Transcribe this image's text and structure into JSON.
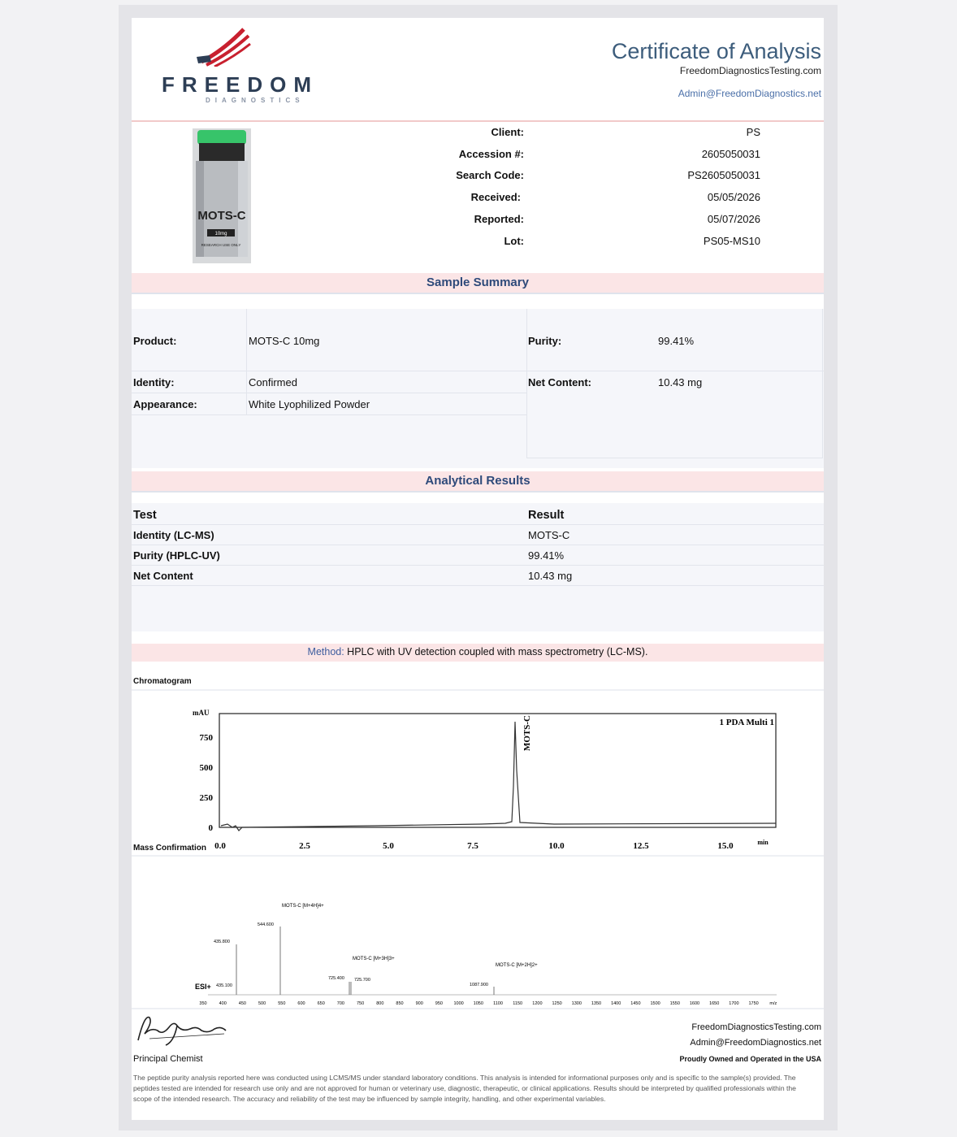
{
  "header": {
    "logo_word": "FREEDOM",
    "logo_sub": "DIAGNOSTICS",
    "title": "Certificate of Analysis",
    "website": "FreedomDiagnosticsTesting.com",
    "email": "Admin@FreedomDiagnostics.net"
  },
  "vial": {
    "label": "MOTS-C",
    "dose": "10mg",
    "note": "RESEARCH USE ONLY"
  },
  "info": [
    {
      "label": "Client:",
      "value": "PS"
    },
    {
      "label": "Accession #:",
      "value": "2605050031"
    },
    {
      "label": "Search Code:",
      "value": "PS2605050031"
    },
    {
      "label": "Received:",
      "value": "05/05/2026"
    },
    {
      "label": "Reported:",
      "value": "05/07/2026"
    },
    {
      "label": "Lot:",
      "value": "PS05-MS10"
    }
  ],
  "sample_summary": {
    "title": "Sample Summary",
    "product_label": "Product:",
    "product": "MOTS-C 10mg",
    "identity_label": "Identity:",
    "identity": "Confirmed",
    "appearance_label": "Appearance:",
    "appearance": "White Lyophilized Powder",
    "purity_label": "Purity:",
    "purity": "99.41%",
    "net_label": "Net Content:",
    "net": "10.43 mg"
  },
  "analytical": {
    "title": "Analytical Results",
    "col_test": "Test",
    "col_result": "Result",
    "rows": [
      {
        "test": "Identity (LC-MS)",
        "result": "MOTS-C"
      },
      {
        "test": "Purity (HPLC-UV)",
        "result": "99.41%"
      },
      {
        "test": "Net Content",
        "result": "10.43 mg"
      }
    ]
  },
  "method": {
    "label": "Method:",
    "text": " HPLC with UV detection coupled with mass spectrometry (LC-MS)."
  },
  "chromatogram": {
    "section": "Chromatogram",
    "y_unit": "mAU",
    "x_unit": "min",
    "legend": "1 PDA Multi 1",
    "peak_label": "MOTS-C",
    "y_ticks": [
      "750",
      "500",
      "250",
      "0"
    ],
    "x_ticks": [
      "0.0",
      "2.5",
      "5.0",
      "7.5",
      "10.0",
      "12.5",
      "15.0"
    ]
  },
  "mass": {
    "section": "Mass Confirmation",
    "mode": "ESI+",
    "x_unit": "m/z",
    "peaks": [
      {
        "mz_label": "435.100"
      },
      {
        "mz_label": "435.800"
      },
      {
        "mz_label": "544.600",
        "name": "MOTS-C [M+4H]4+"
      },
      {
        "mz_label": "725.400"
      },
      {
        "mz_label": "725.700",
        "name": "MOTS-C [M+3H]3+"
      },
      {
        "mz_label": "1087.900",
        "name": "MOTS-C [M+2H]2+"
      }
    ],
    "x_ticks": [
      "350",
      "400",
      "450",
      "500",
      "550",
      "600",
      "650",
      "700",
      "750",
      "800",
      "850",
      "900",
      "950",
      "1000",
      "1050",
      "1100",
      "1150",
      "1200",
      "1250",
      "1300",
      "1350",
      "1400",
      "1450",
      "1500",
      "1550",
      "1600",
      "1650",
      "1700",
      "1750"
    ]
  },
  "footer": {
    "signature": "Alex Johnson",
    "role": "Principal Chemist",
    "website": "FreedomDiagnosticsTesting.com",
    "email": "Admin@FreedomDiagnostics.net",
    "tagline": "Proudly Owned and Operated in the USA",
    "disclaimer": "The peptide purity analysis reported here was conducted using LCMS/MS under standard laboratory conditions. This analysis is intended for informational purposes only and is specific to the sample(s) provided. The peptides tested are intended for research use only and are not approved for human or veterinary use, diagnostic, therapeutic, or clinical applications. Results should be interpreted by qualified professionals within the scope of the intended research. The accuracy and reliability of the test may be influenced by sample integrity, handling, and other experimental variables."
  },
  "colors": {
    "accent": "#3d5d7c",
    "band": "#fbe5e6",
    "flag_red": "#c8202f",
    "flag_blue": "#2d3e55"
  }
}
